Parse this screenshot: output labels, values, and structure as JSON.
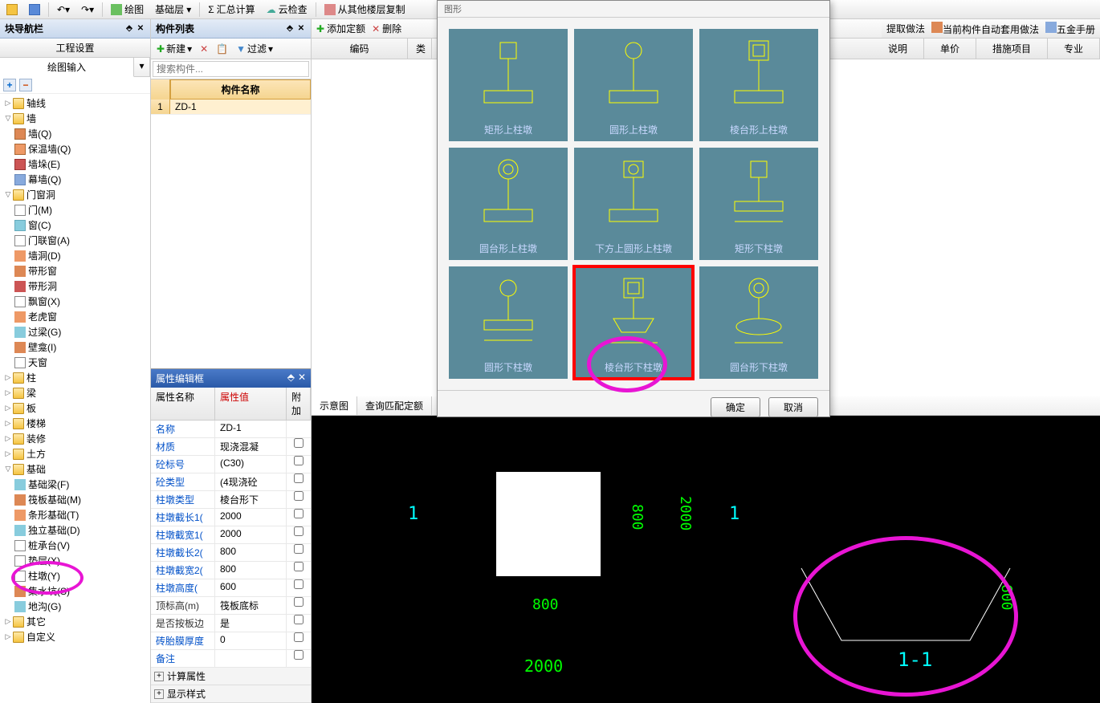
{
  "toolbar": {
    "draw": "绘图",
    "base_layer": "基础层",
    "sum_calc": "汇总计算",
    "cloud_check": "云检查",
    "copy_from": "从其他楼层复制"
  },
  "nav": {
    "title": "块导航栏",
    "sub": "工程设置",
    "tab_draw": "绘图输入",
    "items": {
      "axis": "轴线",
      "wall": "墙",
      "wall_q": "墙(Q)",
      "insul": "保温墙(Q)",
      "wall_duo": "墙垛(E)",
      "curtain": "幕墙(Q)",
      "door": "门窗洞",
      "door_m": "门(M)",
      "window_c": "窗(C)",
      "door_win": "门联窗(A)",
      "wall_hole": "墙洞(D)",
      "strip_win": "带形窗",
      "strip_hole": "带形洞",
      "bay_win": "飘窗(X)",
      "old_win": "老虎窗",
      "lintel": "过梁(G)",
      "niche": "壁龛(I)",
      "skylight": "天窗",
      "column": "柱",
      "beam": "梁",
      "slab": "板",
      "stair": "楼梯",
      "finish": "装修",
      "earth": "土方",
      "foundation": "基础",
      "found_beam": "基础梁(F)",
      "raft": "筏板基础(M)",
      "strip_found": "条形基础(T)",
      "iso_found": "独立基础(D)",
      "pile_cap": "桩承台(V)",
      "bedding": "垫层(X)",
      "pier": "柱墩(Y)",
      "pit": "集水坑(S)",
      "trench": "地沟(G)",
      "other": "其它",
      "custom": "自定义"
    }
  },
  "list": {
    "title": "构件列表",
    "new": "新建",
    "filter": "过滤",
    "search_ph": "搜索构件...",
    "header": "构件名称",
    "row1": "ZD-1"
  },
  "prop": {
    "title": "属性编辑框",
    "h_name": "属性名称",
    "h_value": "属性值",
    "h_add": "附加",
    "rows": [
      {
        "n": "名称",
        "v": "ZD-1",
        "blue": true
      },
      {
        "n": "材质",
        "v": "现浇混凝",
        "blue": true,
        "cb": true
      },
      {
        "n": "砼标号",
        "v": "(C30)",
        "blue": true,
        "cb": true
      },
      {
        "n": "砼类型",
        "v": "(4现浇砼",
        "blue": true,
        "cb": true
      },
      {
        "n": "柱墩类型",
        "v": "棱台形下",
        "blue": true,
        "cb": true
      },
      {
        "n": "柱墩截长1(",
        "v": "2000",
        "blue": true,
        "cb": true
      },
      {
        "n": "柱墩截宽1(",
        "v": "2000",
        "blue": true,
        "cb": true
      },
      {
        "n": "柱墩截长2(",
        "v": "800",
        "blue": true,
        "cb": true
      },
      {
        "n": "柱墩截宽2(",
        "v": "800",
        "blue": true,
        "cb": true
      },
      {
        "n": "柱墩高度(",
        "v": "600",
        "blue": true,
        "cb": true
      },
      {
        "n": "顶标高(m)",
        "v": "筏板底标",
        "blue": false,
        "cb": true
      },
      {
        "n": "是否按板边",
        "v": "是",
        "blue": false,
        "cb": true
      },
      {
        "n": "砖胎膜厚度",
        "v": "0",
        "blue": true,
        "cb": true
      },
      {
        "n": "备注",
        "v": "",
        "blue": true,
        "cb": true
      }
    ],
    "g_calc": "计算属性",
    "g_disp": "显示样式"
  },
  "right": {
    "add": "添加定额",
    "del": "删除",
    "h_code": "编码",
    "h_cls": "类",
    "tab_schem": "示意图",
    "tab_match": "查询匹配定额",
    "tab_q": "查"
  },
  "ext": {
    "extract": "提取做法",
    "auto": "当前构件自动套用做法",
    "manual": "五金手册",
    "h_desc": "说明",
    "h_price": "单价",
    "h_item": "措施项目",
    "h_spec": "专业"
  },
  "dialog": {
    "title": "图形",
    "shapes": [
      "矩形上柱墩",
      "圆形上柱墩",
      "棱台形上柱墩",
      "圆台形上柱墩",
      "下方上圆形上柱墩",
      "矩形下柱墩",
      "圆形下柱墩",
      "棱台形下柱墩",
      "圆台形下柱墩"
    ],
    "ok": "确定",
    "cancel": "取消"
  },
  "canvas": {
    "d800a": "800",
    "d800b": "800",
    "d2000a": "2000",
    "d2000b": "2000",
    "d600": "600",
    "s1a": "1",
    "s1b": "1",
    "s11": "1-1"
  }
}
